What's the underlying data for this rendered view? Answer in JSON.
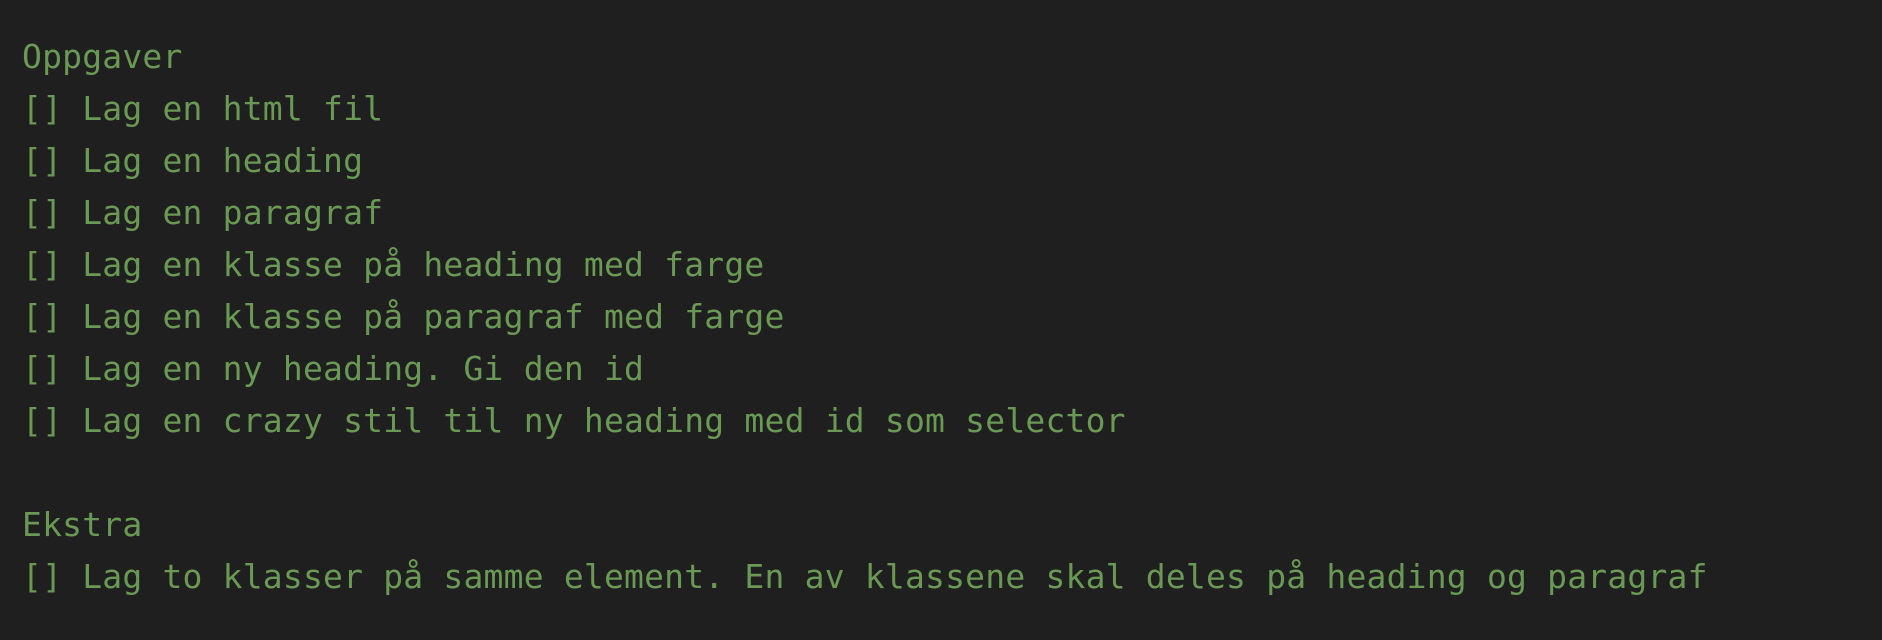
{
  "editor": {
    "text_color": "#6a9955",
    "background": "#1f1f1f",
    "sections": [
      {
        "heading": "Oppgaver",
        "items": [
          "[] Lag en html fil",
          "[] Lag en heading",
          "[] Lag en paragraf",
          "[] Lag en klasse på heading med farge",
          "[] Lag en klasse på paragraf med farge",
          "[] Lag en ny heading. Gi den id",
          "[] Lag en crazy stil til ny heading med id som selector"
        ]
      },
      {
        "heading": "Ekstra",
        "items": [
          "[] Lag to klasser på samme element. En av klassene skal deles på heading og paragraf"
        ]
      }
    ]
  }
}
